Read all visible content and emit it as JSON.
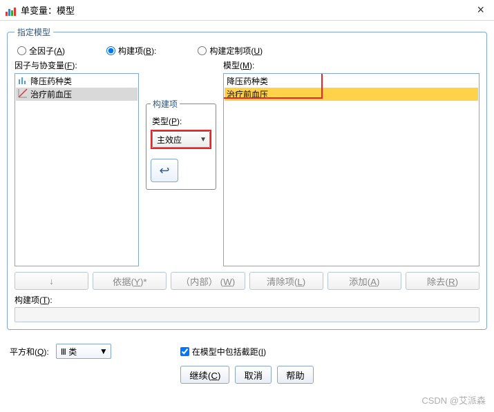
{
  "window": {
    "title": "单变量：模型",
    "close_glyph": "×"
  },
  "specify_model": {
    "legend": "指定模型",
    "full_factorial": "全因子",
    "full_factorial_m": "A",
    "build_terms": "构建项",
    "build_terms_m": "B",
    "build_custom": "构建定制项",
    "build_custom_m": "U",
    "selected": "build_terms"
  },
  "factors": {
    "label": "因子与协变量",
    "label_m": "F",
    "items": [
      {
        "text": "降压药种类",
        "kind": "cat",
        "selected": false
      },
      {
        "text": "治疗前血压",
        "kind": "cov",
        "selected": true
      }
    ]
  },
  "build": {
    "legend": "构建项",
    "type_label": "类型",
    "type_label_m": "P",
    "type_value": "主效应",
    "arrow_glyph": "↩"
  },
  "model": {
    "label": "模型",
    "label_m": "M",
    "items": [
      {
        "text": "降压药种类",
        "selected": false
      },
      {
        "text": "治疗前血压",
        "selected": true
      }
    ]
  },
  "term_buttons": {
    "down_glyph": "↓",
    "by": "依据",
    "by_m": "Y",
    "within": "（内部）",
    "within_m": "W",
    "clear": "清除项",
    "clear_m": "L",
    "add": "添加",
    "add_m": "A",
    "remove": "除去",
    "remove_m": "R"
  },
  "build_term": {
    "label": "构建项",
    "label_m": "T"
  },
  "bottom": {
    "sos_label": "平方和",
    "sos_label_m": "Q",
    "sos_value": "Ⅲ 类",
    "intercept": "在模型中包括截距",
    "intercept_m": "I",
    "intercept_checked": true
  },
  "dialog": {
    "continue": "继续",
    "continue_m": "C",
    "cancel": "取消",
    "help": "帮助"
  },
  "watermark": "CSDN @艾派森"
}
